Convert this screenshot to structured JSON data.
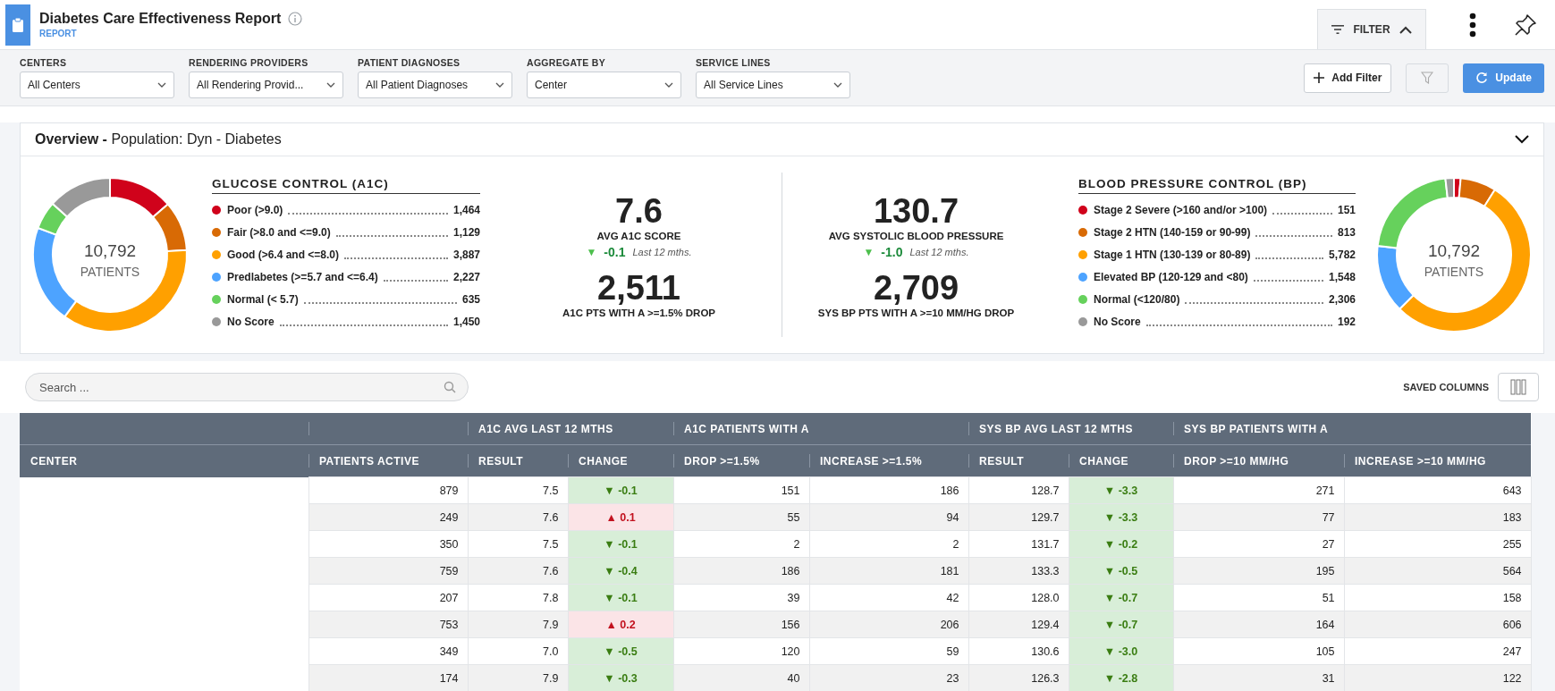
{
  "header": {
    "title": "Diabetes Care Effectiveness Report",
    "subtitle": "REPORT",
    "filter_tab": {
      "label": "FILTER",
      "expanded": true
    }
  },
  "filters": [
    {
      "label": "CENTERS",
      "value": "All Centers"
    },
    {
      "label": "RENDERING PROVIDERS",
      "value": "All Rendering Provid..."
    },
    {
      "label": "PATIENT DIAGNOSES",
      "value": "All Patient Diagnoses"
    },
    {
      "label": "AGGREGATE BY",
      "value": "Center"
    },
    {
      "label": "SERVICE LINES",
      "value": "All Service Lines"
    }
  ],
  "filter_actions": {
    "add": "Add Filter",
    "update": "Update"
  },
  "overview": {
    "title": "**Overview -** Population: Dyn - Diabetes",
    "panels": [
      {
        "title": "GLUCOSE CONTROL (A1C)",
        "center_value": "10,792",
        "center_label": "PATIENTS",
        "legend": [
          {
            "label": "Poor (>9.0)",
            "value": "1,464",
            "color": "#d0021b"
          },
          {
            "label": "Fair (>8.0 and <=9.0)",
            "value": "1,129",
            "color": "#d86a05"
          },
          {
            "label": "Good (>6.4 and <=8.0)",
            "value": "3,887",
            "color": "#ffa000"
          },
          {
            "label": "Predlabetes (>=5.7 and <=6.4)",
            "value": "2,227",
            "color": "#4da3ff"
          },
          {
            "label": "Normal (< 5.7)",
            "value": "635",
            "color": "#66d15c"
          },
          {
            "label": "No Score",
            "value": "1,450",
            "color": "#999999"
          }
        ],
        "stat": {
          "value": "7.6",
          "label": "AVG A1C SCORE",
          "arrow": "▼",
          "change": "-0.1",
          "favorable": true,
          "period": "Last 12 mths.",
          "count": "2,511",
          "count_label": "A1C PTS WITH A >=1.5% DROP"
        }
      },
      {
        "title": "BLOOD PRESSURE CONTROL (BP)",
        "center_value": "10,792",
        "center_label": "PATIENTS",
        "legend": [
          {
            "label": "Stage 2 Severe (>160 and/or >100)",
            "value": "151",
            "color": "#d0021b"
          },
          {
            "label": "Stage 2 HTN (140-159 or 90-99)",
            "value": "813",
            "color": "#d86a05"
          },
          {
            "label": "Stage 1 HTN (130-139 or 80-89)",
            "value": "5,782",
            "color": "#ffa000"
          },
          {
            "label": "Elevated BP (120-129 and <80)",
            "value": "1,548",
            "color": "#4da3ff"
          },
          {
            "label": "Normal (<120/80)",
            "value": "2,306",
            "color": "#66d15c"
          },
          {
            "label": "No Score",
            "value": "192",
            "color": "#999999"
          }
        ],
        "stat": {
          "value": "130.7",
          "label": "AVG SYSTOLIC BLOOD PRESSURE",
          "arrow": "▼",
          "change": "-1.0",
          "favorable": true,
          "period": "Last 12 mths.",
          "count": "2,709",
          "count_label": "SYS BP PTS WITH A >=10 MM/HG DROP"
        }
      }
    ]
  },
  "search": {
    "placeholder": "Search ..."
  },
  "saved_columns": "SAVED COLUMNS",
  "table": {
    "groups": [
      "A1C AVG LAST 12 MTHS",
      "A1C PATIENTS WITH A",
      "SYS BP AVG LAST 12 MTHS",
      "SYS BP PATIENTS WITH A"
    ],
    "columns": [
      "CENTER",
      "PATIENTS ACTIVE",
      "RESULT",
      "CHANGE",
      "DROP >=1.5%",
      "INCREASE >=1.5%",
      "RESULT",
      "CHANGE",
      "DROP >=10 MM/HG",
      "INCREASE >=10 MM/HG"
    ],
    "rows": [
      {
        "active": "879",
        "a1c_result": "7.5",
        "a1c_change": {
          "arrow": "▼",
          "text": "-0.1",
          "favorable": true
        },
        "a1c_drop": "151",
        "a1c_increase": "186",
        "bp_result": "128.7",
        "bp_change": {
          "arrow": "▼",
          "text": "-3.3",
          "favorable": true
        },
        "bp_drop": "271",
        "bp_increase": "643"
      },
      {
        "active": "249",
        "a1c_result": "7.6",
        "a1c_change": {
          "arrow": "▲",
          "text": "0.1",
          "favorable": false
        },
        "a1c_drop": "55",
        "a1c_increase": "94",
        "bp_result": "129.7",
        "bp_change": {
          "arrow": "▼",
          "text": "-3.3",
          "favorable": true
        },
        "bp_drop": "77",
        "bp_increase": "183"
      },
      {
        "active": "350",
        "a1c_result": "7.5",
        "a1c_change": {
          "arrow": "▼",
          "text": "-0.1",
          "favorable": true
        },
        "a1c_drop": "2",
        "a1c_increase": "2",
        "bp_result": "131.7",
        "bp_change": {
          "arrow": "▼",
          "text": "-0.2",
          "favorable": true
        },
        "bp_drop": "27",
        "bp_increase": "255"
      },
      {
        "active": "759",
        "a1c_result": "7.6",
        "a1c_change": {
          "arrow": "▼",
          "text": "-0.4",
          "favorable": true
        },
        "a1c_drop": "186",
        "a1c_increase": "181",
        "bp_result": "133.3",
        "bp_change": {
          "arrow": "▼",
          "text": "-0.5",
          "favorable": true
        },
        "bp_drop": "195",
        "bp_increase": "564"
      },
      {
        "active": "207",
        "a1c_result": "7.8",
        "a1c_change": {
          "arrow": "▼",
          "text": "-0.1",
          "favorable": true
        },
        "a1c_drop": "39",
        "a1c_increase": "42",
        "bp_result": "128.0",
        "bp_change": {
          "arrow": "▼",
          "text": "-0.7",
          "favorable": true
        },
        "bp_drop": "51",
        "bp_increase": "158"
      },
      {
        "active": "753",
        "a1c_result": "7.9",
        "a1c_change": {
          "arrow": "▲",
          "text": "0.2",
          "favorable": false
        },
        "a1c_drop": "156",
        "a1c_increase": "206",
        "bp_result": "129.4",
        "bp_change": {
          "arrow": "▼",
          "text": "-0.7",
          "favorable": true
        },
        "bp_drop": "164",
        "bp_increase": "606"
      },
      {
        "active": "349",
        "a1c_result": "7.0",
        "a1c_change": {
          "arrow": "▼",
          "text": "-0.5",
          "favorable": true
        },
        "a1c_drop": "120",
        "a1c_increase": "59",
        "bp_result": "130.6",
        "bp_change": {
          "arrow": "▼",
          "text": "-3.0",
          "favorable": true
        },
        "bp_drop": "105",
        "bp_increase": "247"
      },
      {
        "active": "174",
        "a1c_result": "7.9",
        "a1c_change": {
          "arrow": "▼",
          "text": "-0.3",
          "favorable": true
        },
        "a1c_drop": "40",
        "a1c_increase": "23",
        "bp_result": "126.3",
        "bp_change": {
          "arrow": "▼",
          "text": "-2.8",
          "favorable": true
        },
        "bp_drop": "31",
        "bp_increase": "122"
      }
    ]
  }
}
